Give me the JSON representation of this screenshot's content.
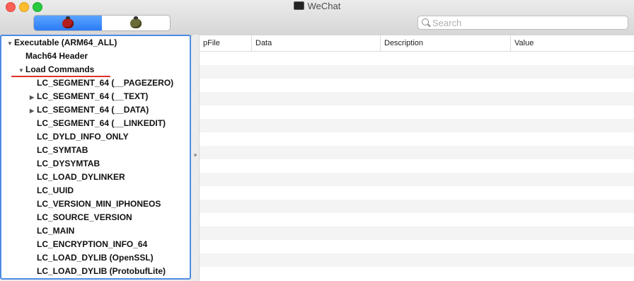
{
  "window": {
    "title": "WeChat"
  },
  "toolbar": {
    "mode_buttons": [
      {
        "icon": "red-bug-icon"
      },
      {
        "icon": "olive-bug-icon"
      }
    ],
    "search": {
      "placeholder": "Search",
      "value": ""
    }
  },
  "tree": [
    {
      "label": "Executable  (ARM64_ALL)",
      "expanded": true
    },
    {
      "label": "Mach64 Header"
    },
    {
      "label": "Load Commands",
      "expanded": true
    },
    {
      "label": "LC_SEGMENT_64 (__PAGEZERO)"
    },
    {
      "label": "LC_SEGMENT_64 (__TEXT)",
      "expanded": false
    },
    {
      "label": "LC_SEGMENT_64 (__DATA)",
      "expanded": false
    },
    {
      "label": "LC_SEGMENT_64 (__LINKEDIT)"
    },
    {
      "label": "LC_DYLD_INFO_ONLY"
    },
    {
      "label": "LC_SYMTAB"
    },
    {
      "label": "LC_DYSYMTAB"
    },
    {
      "label": "LC_LOAD_DYLINKER"
    },
    {
      "label": "LC_UUID"
    },
    {
      "label": "LC_VERSION_MIN_IPHONEOS"
    },
    {
      "label": "LC_SOURCE_VERSION"
    },
    {
      "label": "LC_MAIN"
    },
    {
      "label": "LC_ENCRYPTION_INFO_64"
    },
    {
      "label": "LC_LOAD_DYLIB (OpenSSL)"
    },
    {
      "label": "LC_LOAD_DYLIB (ProtobufLite)"
    }
  ],
  "table": {
    "columns": [
      "pFile",
      "Data",
      "Description",
      "Value"
    ],
    "rows": []
  }
}
